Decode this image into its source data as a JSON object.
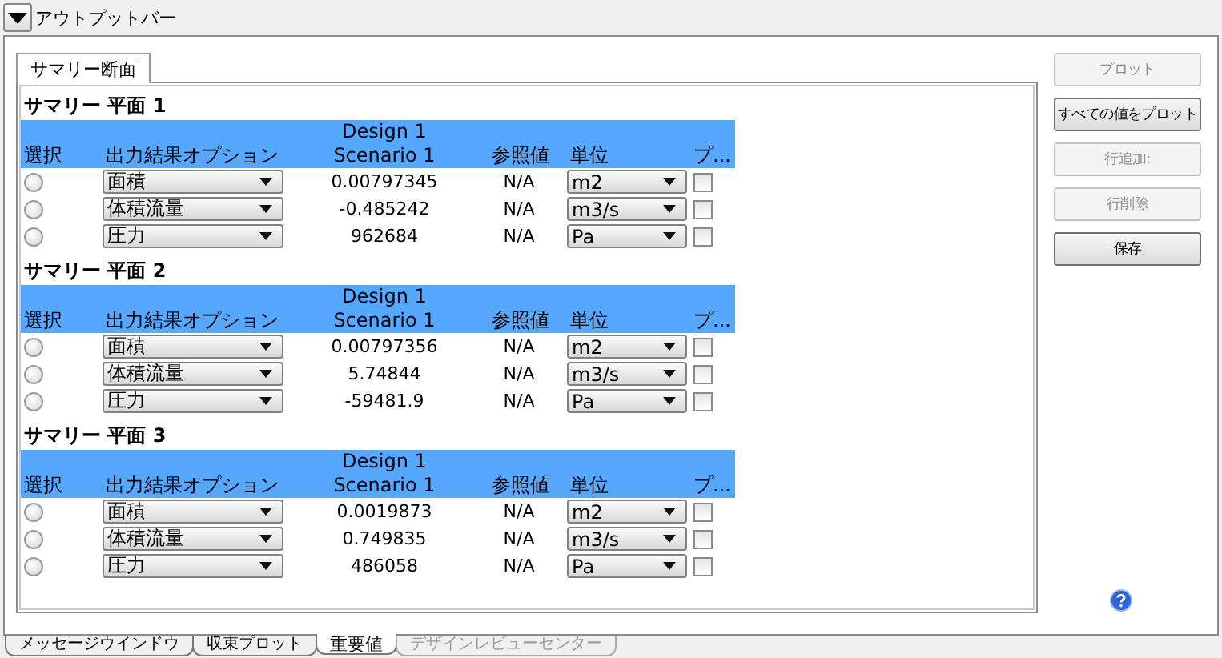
{
  "output_bar": {
    "title": "アウトプットバー"
  },
  "panel_tab": {
    "label": "サマリー断面",
    "selected": true
  },
  "sections": [
    {
      "title": "サマリー 平面 1",
      "design": "Design 1",
      "columns": [
        "選択",
        "出力結果オプション",
        "Scenario 1",
        "参照値",
        "単位",
        "プ..."
      ],
      "rows": [
        {
          "selected": false,
          "option": "面積",
          "value": "0.00797345",
          "reference": "N/A",
          "unit": "m2",
          "checked": false
        },
        {
          "selected": false,
          "option": "体積流量",
          "value": "-0.485242",
          "reference": "N/A",
          "unit": "m3/s",
          "checked": false
        },
        {
          "selected": false,
          "option": "圧力",
          "value": "962684",
          "reference": "N/A",
          "unit": "Pa",
          "checked": false
        }
      ]
    },
    {
      "title": "サマリー 平面 2",
      "design": "Design 1",
      "columns": [
        "選択",
        "出力結果オプション",
        "Scenario 1",
        "参照値",
        "単位",
        "プ..."
      ],
      "rows": [
        {
          "selected": false,
          "option": "面積",
          "value": "0.00797356",
          "reference": "N/A",
          "unit": "m2",
          "checked": false
        },
        {
          "selected": false,
          "option": "体積流量",
          "value": "5.74844",
          "reference": "N/A",
          "unit": "m3/s",
          "checked": false
        },
        {
          "selected": false,
          "option": "圧力",
          "value": "-59481.9",
          "reference": "N/A",
          "unit": "Pa",
          "checked": false
        }
      ]
    },
    {
      "title": "サマリー 平面 3",
      "design": "Design 1",
      "columns": [
        "選択",
        "出力結果オプション",
        "Scenario 1",
        "参照値",
        "単位",
        "プ..."
      ],
      "rows": [
        {
          "selected": false,
          "option": "面積",
          "value": "0.0019873",
          "reference": "N/A",
          "unit": "m2",
          "checked": false
        },
        {
          "selected": false,
          "option": "体積流量",
          "value": "0.749835",
          "reference": "N/A",
          "unit": "m3/s",
          "checked": false
        },
        {
          "selected": false,
          "option": "圧力",
          "value": "486058",
          "reference": "N/A",
          "unit": "Pa",
          "checked": false
        }
      ]
    }
  ],
  "buttons": [
    {
      "label": "プロット",
      "disabled": true
    },
    {
      "label": "すべての値をプロット",
      "disabled": false
    },
    {
      "label": "行追加:",
      "disabled": true
    },
    {
      "label": "行削除",
      "disabled": true
    },
    {
      "label": "保存",
      "disabled": false
    }
  ],
  "bottom_tabs": [
    {
      "label": "メッセージウインドウ",
      "selected": false,
      "disabled": false
    },
    {
      "label": "収束プロット",
      "selected": false,
      "disabled": false
    },
    {
      "label": "重要値",
      "selected": true,
      "disabled": false
    },
    {
      "label": "デザインレビューセンター",
      "selected": false,
      "disabled": true
    }
  ]
}
